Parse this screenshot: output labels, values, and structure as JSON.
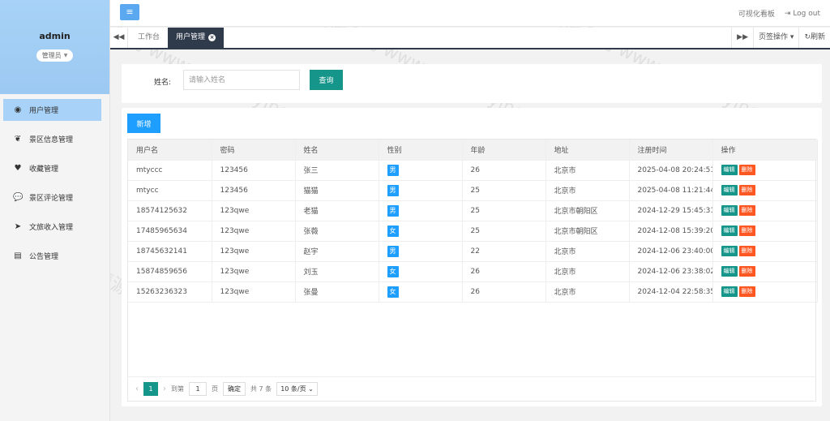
{
  "sidebar": {
    "username": "admin",
    "role": "管理员",
    "items": [
      {
        "label": "用户管理",
        "active": true
      },
      {
        "label": "景区信息管理"
      },
      {
        "label": "收藏管理"
      },
      {
        "label": "景区评论管理"
      },
      {
        "label": "文旅收入管理"
      },
      {
        "label": "公告管理"
      }
    ]
  },
  "topbar": {
    "dashboard": "可视化看板",
    "logout": "Log out"
  },
  "tabs": {
    "home": "工作台",
    "current": "用户管理",
    "page_ops": "页签操作",
    "refresh": "刷新"
  },
  "search": {
    "label": "姓名:",
    "placeholder": "请输入姓名",
    "button": "查询"
  },
  "table": {
    "add_button": "新增",
    "headers": [
      "用户名",
      "密码",
      "姓名",
      "性别",
      "年龄",
      "地址",
      "注册时间",
      "操作"
    ],
    "rows": [
      [
        "mtyccc",
        "123456",
        "张三",
        "男",
        "26",
        "北京市",
        "2025-04-08 20:24:51"
      ],
      [
        "mtycc",
        "123456",
        "猫猫",
        "男",
        "25",
        "北京市",
        "2025-04-08 11:21:44"
      ],
      [
        "18574125632",
        "123qwe",
        "老猫",
        "男",
        "25",
        "北京市朝阳区",
        "2024-12-29 15:45:31"
      ],
      [
        "17485965634",
        "123qwe",
        "张薇",
        "女",
        "25",
        "北京市朝阳区",
        "2024-12-08 15:39:20"
      ],
      [
        "18745632141",
        "123qwe",
        "赵宇",
        "男",
        "22",
        "北京市",
        "2024-12-06 23:40:00"
      ],
      [
        "15874859656",
        "123qwe",
        "刘玉",
        "女",
        "26",
        "北京市",
        "2024-12-06 23:38:02"
      ],
      [
        "15263236323",
        "123qwe",
        "张曼",
        "女",
        "26",
        "北京市",
        "2024-12-04 22:58:35"
      ]
    ],
    "edit_label": "编辑",
    "delete_label": "删除"
  },
  "pager": {
    "current": "1",
    "goto": "到第",
    "page_input": "1",
    "page_unit": "页",
    "confirm": "确定",
    "total": "共 7 条",
    "page_size": "10 条/页"
  },
  "watermark": "©猫头鹰源码 www.maotouyingcc.com"
}
